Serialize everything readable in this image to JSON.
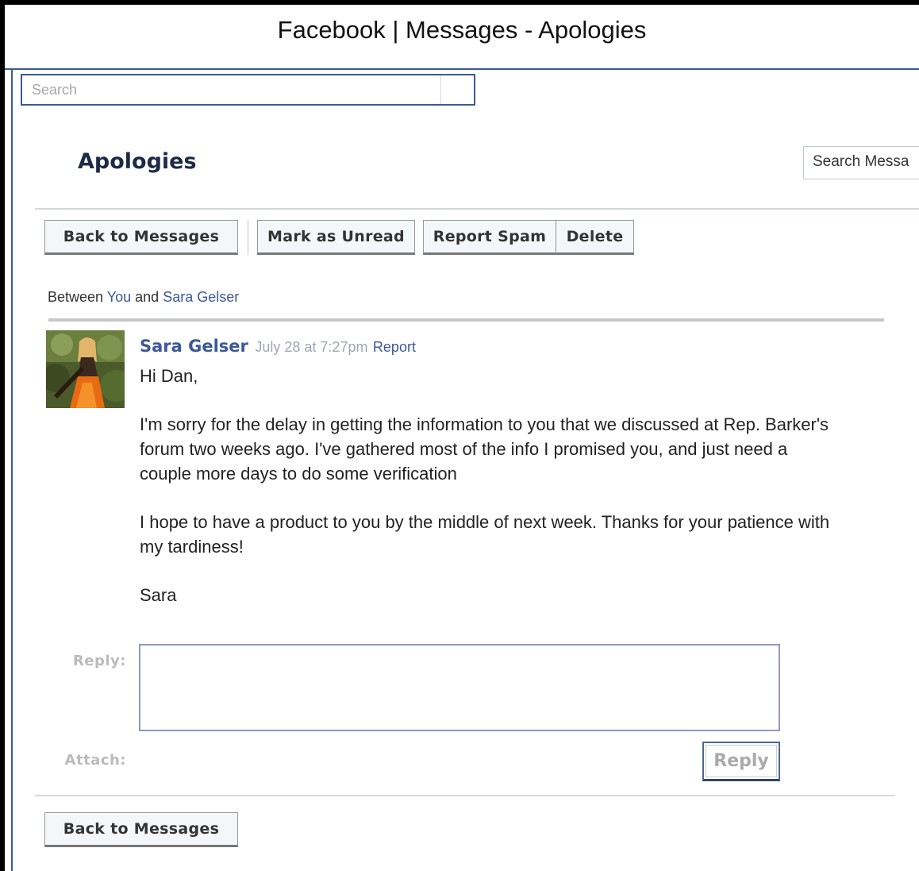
{
  "window": {
    "title": "Facebook | Messages - Apologies"
  },
  "search": {
    "placeholder": "Search"
  },
  "page": {
    "title": "Apologies",
    "search_messages_label": "Search Messa"
  },
  "toolbar": {
    "back_label": "Back to Messages",
    "mark_unread_label": "Mark as Unread",
    "report_spam_label": "Report Spam",
    "delete_label": "Delete"
  },
  "participants": {
    "prefix": "Between",
    "you": "You",
    "conjunction": "and",
    "other": "Sara Gelser"
  },
  "message": {
    "sender": "Sara Gelser",
    "timestamp": "July 28 at 7:27pm",
    "report_label": "Report",
    "paragraphs": [
      "Hi Dan,",
      "I'm sorry for the delay in getting the information to you that we discussed at Rep. Barker's forum two weeks ago. I've gathered most of the info I promised you, and just need a couple more days to do some verification",
      "I hope to have a product to you by the middle of next week. Thanks for your patience with my tardiness!",
      "Sara"
    ]
  },
  "reply_form": {
    "reply_label": "Reply:",
    "attach_label": "Attach:",
    "reply_button": "Reply",
    "reply_value": ""
  },
  "footer": {
    "back_label": "Back to Messages"
  },
  "colors": {
    "brand": "#3b5998",
    "title_text": "#1c2a47",
    "muted": "#a0a6b3"
  }
}
